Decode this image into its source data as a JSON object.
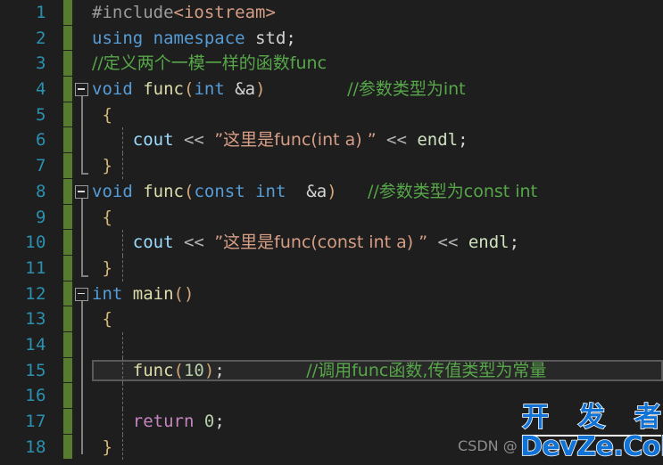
{
  "editor": {
    "language": "cpp",
    "background_color": "#1e1e1e",
    "line_number_color": "#2b91af",
    "change_bar_color": "#587c2f",
    "current_line": 15,
    "total_visible_lines": 18
  },
  "line_numbers": [
    "1",
    "2",
    "3",
    "4",
    "5",
    "6",
    "7",
    "8",
    "9",
    "10",
    "11",
    "12",
    "13",
    "14",
    "15",
    "16",
    "17",
    "18"
  ],
  "code_lines": [
    {
      "number": "1",
      "tokens": [
        {
          "text": "#include",
          "kind": "preprocessor"
        },
        {
          "text": "<iostream>",
          "kind": "include-path"
        }
      ]
    },
    {
      "number": "2",
      "tokens": [
        {
          "text": "using",
          "kind": "keyword"
        },
        {
          "text": " ",
          "kind": "plain"
        },
        {
          "text": "namespace",
          "kind": "keyword"
        },
        {
          "text": " ",
          "kind": "plain"
        },
        {
          "text": "std",
          "kind": "plain"
        },
        {
          "text": ";",
          "kind": "punct"
        }
      ]
    },
    {
      "number": "3",
      "tokens": [
        {
          "text": "//定义两个一模一样的函数func",
          "kind": "comment"
        }
      ]
    },
    {
      "number": "4",
      "tokens": [
        {
          "text": "void",
          "kind": "keyword"
        },
        {
          "text": " ",
          "kind": "plain"
        },
        {
          "text": "func",
          "kind": "function"
        },
        {
          "text": "(",
          "kind": "paren"
        },
        {
          "text": "int",
          "kind": "keyword"
        },
        {
          "text": " &a",
          "kind": "plain"
        },
        {
          "text": ")",
          "kind": "paren"
        },
        {
          "text": "        ",
          "kind": "plain"
        },
        {
          "text": "//参数类型为int",
          "kind": "comment"
        }
      ]
    },
    {
      "number": "5",
      "tokens": [
        {
          "text": " {",
          "kind": "brace"
        }
      ]
    },
    {
      "number": "6",
      "tokens": [
        {
          "text": "    ",
          "kind": "plain"
        },
        {
          "text": "cout",
          "kind": "object"
        },
        {
          "text": " ",
          "kind": "plain"
        },
        {
          "text": "<<",
          "kind": "operator"
        },
        {
          "text": " ",
          "kind": "plain"
        },
        {
          "text": "”这里是func(int a) ”",
          "kind": "string"
        },
        {
          "text": " ",
          "kind": "plain"
        },
        {
          "text": "<<",
          "kind": "operator"
        },
        {
          "text": " ",
          "kind": "plain"
        },
        {
          "text": "endl",
          "kind": "endl"
        },
        {
          "text": ";",
          "kind": "punct"
        }
      ]
    },
    {
      "number": "7",
      "tokens": [
        {
          "text": " }",
          "kind": "brace"
        }
      ]
    },
    {
      "number": "8",
      "tokens": [
        {
          "text": "void",
          "kind": "keyword"
        },
        {
          "text": " ",
          "kind": "plain"
        },
        {
          "text": "func",
          "kind": "function"
        },
        {
          "text": "(",
          "kind": "paren"
        },
        {
          "text": "const",
          "kind": "keyword"
        },
        {
          "text": " ",
          "kind": "plain"
        },
        {
          "text": "int",
          "kind": "keyword"
        },
        {
          "text": "  &a",
          "kind": "plain"
        },
        {
          "text": ")",
          "kind": "paren"
        },
        {
          "text": "   ",
          "kind": "plain"
        },
        {
          "text": "//参数类型为const int",
          "kind": "comment"
        }
      ]
    },
    {
      "number": "9",
      "tokens": [
        {
          "text": " {",
          "kind": "brace"
        }
      ]
    },
    {
      "number": "10",
      "tokens": [
        {
          "text": "    ",
          "kind": "plain"
        },
        {
          "text": "cout",
          "kind": "object"
        },
        {
          "text": " ",
          "kind": "plain"
        },
        {
          "text": "<<",
          "kind": "operator"
        },
        {
          "text": " ",
          "kind": "plain"
        },
        {
          "text": "”这里是func(const int a) ”",
          "kind": "string"
        },
        {
          "text": " ",
          "kind": "plain"
        },
        {
          "text": "<<",
          "kind": "operator"
        },
        {
          "text": " ",
          "kind": "plain"
        },
        {
          "text": "endl",
          "kind": "endl"
        },
        {
          "text": ";",
          "kind": "punct"
        }
      ]
    },
    {
      "number": "11",
      "tokens": [
        {
          "text": " }",
          "kind": "brace"
        }
      ]
    },
    {
      "number": "12",
      "tokens": [
        {
          "text": "int",
          "kind": "keyword"
        },
        {
          "text": " ",
          "kind": "plain"
        },
        {
          "text": "main",
          "kind": "function"
        },
        {
          "text": "()",
          "kind": "paren"
        }
      ]
    },
    {
      "number": "13",
      "tokens": [
        {
          "text": " {",
          "kind": "brace"
        }
      ]
    },
    {
      "number": "14",
      "tokens": []
    },
    {
      "number": "15",
      "tokens": [
        {
          "text": "    ",
          "kind": "plain"
        },
        {
          "text": "func",
          "kind": "function"
        },
        {
          "text": "(",
          "kind": "paren"
        },
        {
          "text": "10",
          "kind": "number"
        },
        {
          "text": ")",
          "kind": "paren"
        },
        {
          "text": ";",
          "kind": "punct"
        },
        {
          "text": "        ",
          "kind": "plain"
        },
        {
          "text": "//调用func函数,传值类型为常量",
          "kind": "comment"
        }
      ]
    },
    {
      "number": "16",
      "tokens": []
    },
    {
      "number": "17",
      "tokens": [
        {
          "text": "    ",
          "kind": "plain"
        },
        {
          "text": "return",
          "kind": "return-keyword"
        },
        {
          "text": " ",
          "kind": "plain"
        },
        {
          "text": "0",
          "kind": "number"
        },
        {
          "text": ";",
          "kind": "punct"
        }
      ]
    },
    {
      "number": "18",
      "tokens": [
        {
          "text": " }",
          "kind": "brace"
        }
      ]
    }
  ],
  "fold_markers": [
    {
      "line": 4,
      "collapsed": false
    },
    {
      "line": 8,
      "collapsed": false
    },
    {
      "line": 12,
      "collapsed": false
    }
  ],
  "watermark": {
    "csdn_text": "CSDN @",
    "logo_top_chars": [
      "开",
      "发",
      "者"
    ],
    "logo_bottom": "DevZe.CoM",
    "logo_color": "#1273d6",
    "csdn_color": "#8d8d8d"
  }
}
